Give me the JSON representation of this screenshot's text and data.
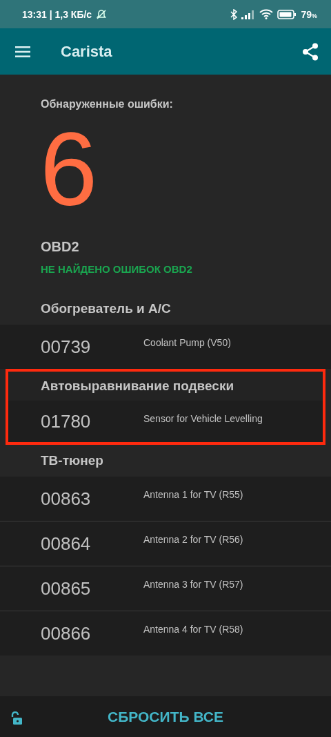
{
  "status_bar": {
    "time": "13:31 | 1,3 КБ/с",
    "battery": "79",
    "battery_unit": "%"
  },
  "app_bar": {
    "title": "Carista"
  },
  "summary": {
    "label": "Обнаруженные ошибки:",
    "count": "6"
  },
  "obd": {
    "title": "OBD2",
    "message": "НЕ НАЙДЕНО ОШИБОК OBD2"
  },
  "sections": [
    {
      "title": "Обогреватель и A/C",
      "highlighted": false,
      "faults": [
        {
          "code": "00739",
          "description": "Coolant Pump (V50)"
        }
      ]
    },
    {
      "title": "Автовыравнивание подвески",
      "highlighted": true,
      "faults": [
        {
          "code": "01780",
          "description": "Sensor for Vehicle Levelling"
        }
      ]
    },
    {
      "title": "ТВ-тюнер",
      "highlighted": false,
      "faults": [
        {
          "code": "00863",
          "description": "Antenna 1 for TV (R55)"
        },
        {
          "code": "00864",
          "description": "Antenna 2 for TV (R56)"
        },
        {
          "code": "00865",
          "description": "Antenna 3 for TV (R57)"
        },
        {
          "code": "00866",
          "description": "Antenna 4 for TV (R58)"
        }
      ]
    }
  ],
  "bottom_bar": {
    "button": "СБРОСИТЬ ВСЕ"
  }
}
